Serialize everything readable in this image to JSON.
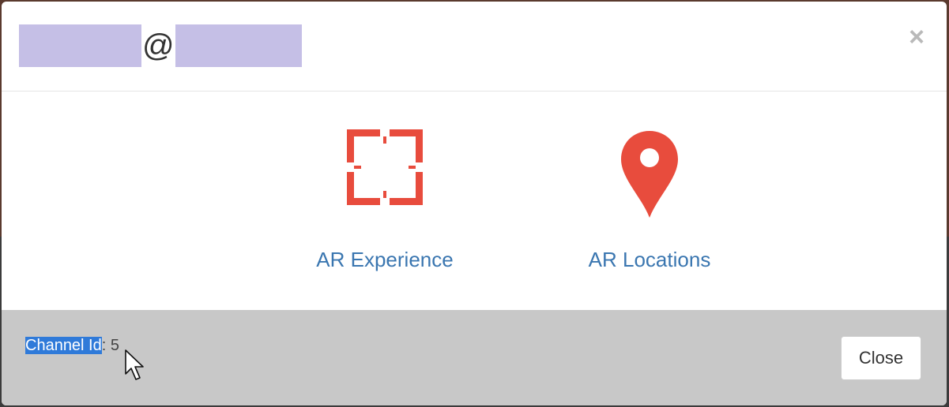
{
  "dialog": {
    "title_separator": "@",
    "close_glyph": "×"
  },
  "tiles": [
    {
      "label": "AR Experience",
      "icon": "frame-corners-icon"
    },
    {
      "label": "AR Locations",
      "icon": "map-pin-icon"
    }
  ],
  "footer": {
    "channel_label": "Channel Id",
    "channel_separator": ": ",
    "channel_value": "5",
    "close_label": "Close"
  },
  "colors": {
    "accent": "#e84c3d",
    "link": "#3a76b0",
    "footer_bg": "#c8c8c8",
    "selection": "#2f7ad9",
    "redaction": "#c5bfe6"
  }
}
